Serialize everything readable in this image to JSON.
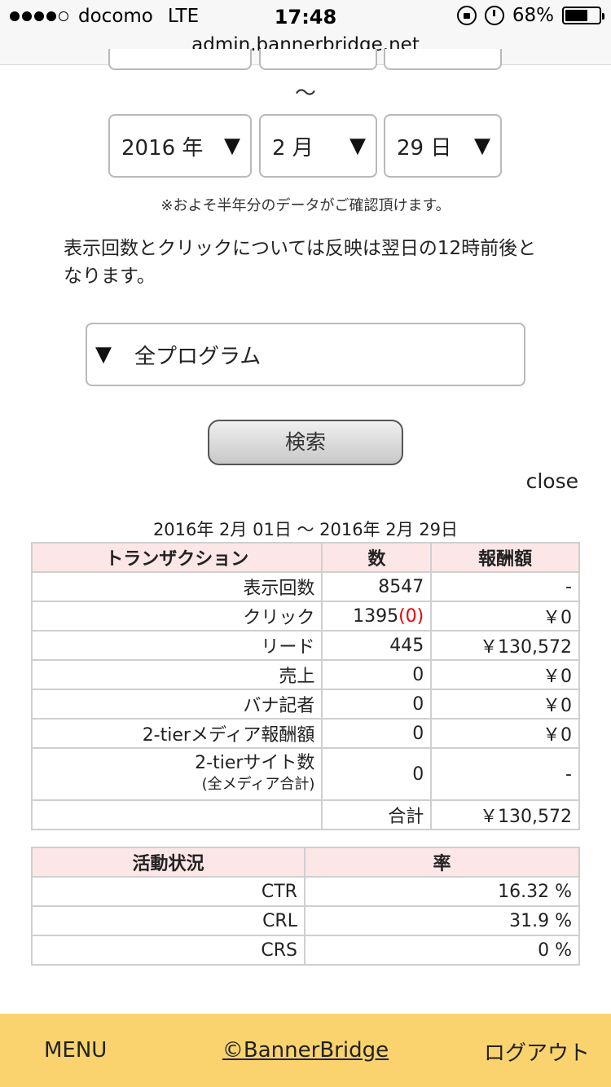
{
  "status_bar": {
    "carrier": "docomo",
    "network": "LTE",
    "time": "17:48",
    "battery": "68%",
    "battery_level": 0.68
  },
  "url": "admin.bannerbridge.net",
  "range_tilde": "～",
  "end_date": {
    "year": "2016 年",
    "month": "2 月",
    "day": "29 日",
    "arrow": "▼"
  },
  "note": "※およそ半年分のデータがご確認頂けます。",
  "info_text": "表示回数とクリックについては反映は翌日の12時前後となります。",
  "program_select": {
    "arrow": "▼",
    "value": "全プログラム"
  },
  "search_button": "検索",
  "close_link": "close",
  "date_range": "2016年 2月 01日 ～ 2016年 2月 29日",
  "transactions": {
    "headers": [
      "トランザクション",
      "数",
      "報酬額"
    ],
    "rows": [
      {
        "label": "表示回数",
        "count": "8547",
        "reward": "-"
      },
      {
        "label": "クリック",
        "count": "1395",
        "count_extra": "(0)",
        "reward": "￥0"
      },
      {
        "label": "リード",
        "count": "445",
        "reward": "￥130,572"
      },
      {
        "label": "売上",
        "count": "0",
        "reward": "￥0"
      },
      {
        "label": "バナ記者",
        "count": "0",
        "reward": "￥0"
      },
      {
        "label": "2-tierメディア報酬額",
        "count": "0",
        "reward": "￥0"
      },
      {
        "label": "2-tierサイト数",
        "sub": "(全メディア合計)",
        "count": "0",
        "reward": "-"
      }
    ],
    "total_label": "合計",
    "total_value": "￥130,572"
  },
  "activity": {
    "headers": [
      "活動状況",
      "率"
    ],
    "rows": [
      {
        "label": "CTR",
        "value": "16.32 %"
      },
      {
        "label": "CRL",
        "value": "31.9 %"
      },
      {
        "label": "CRS",
        "value": "0 %"
      }
    ]
  },
  "footer": {
    "menu": "MENU",
    "copyright": "©BannerBridge",
    "logout": "ログアウト"
  }
}
